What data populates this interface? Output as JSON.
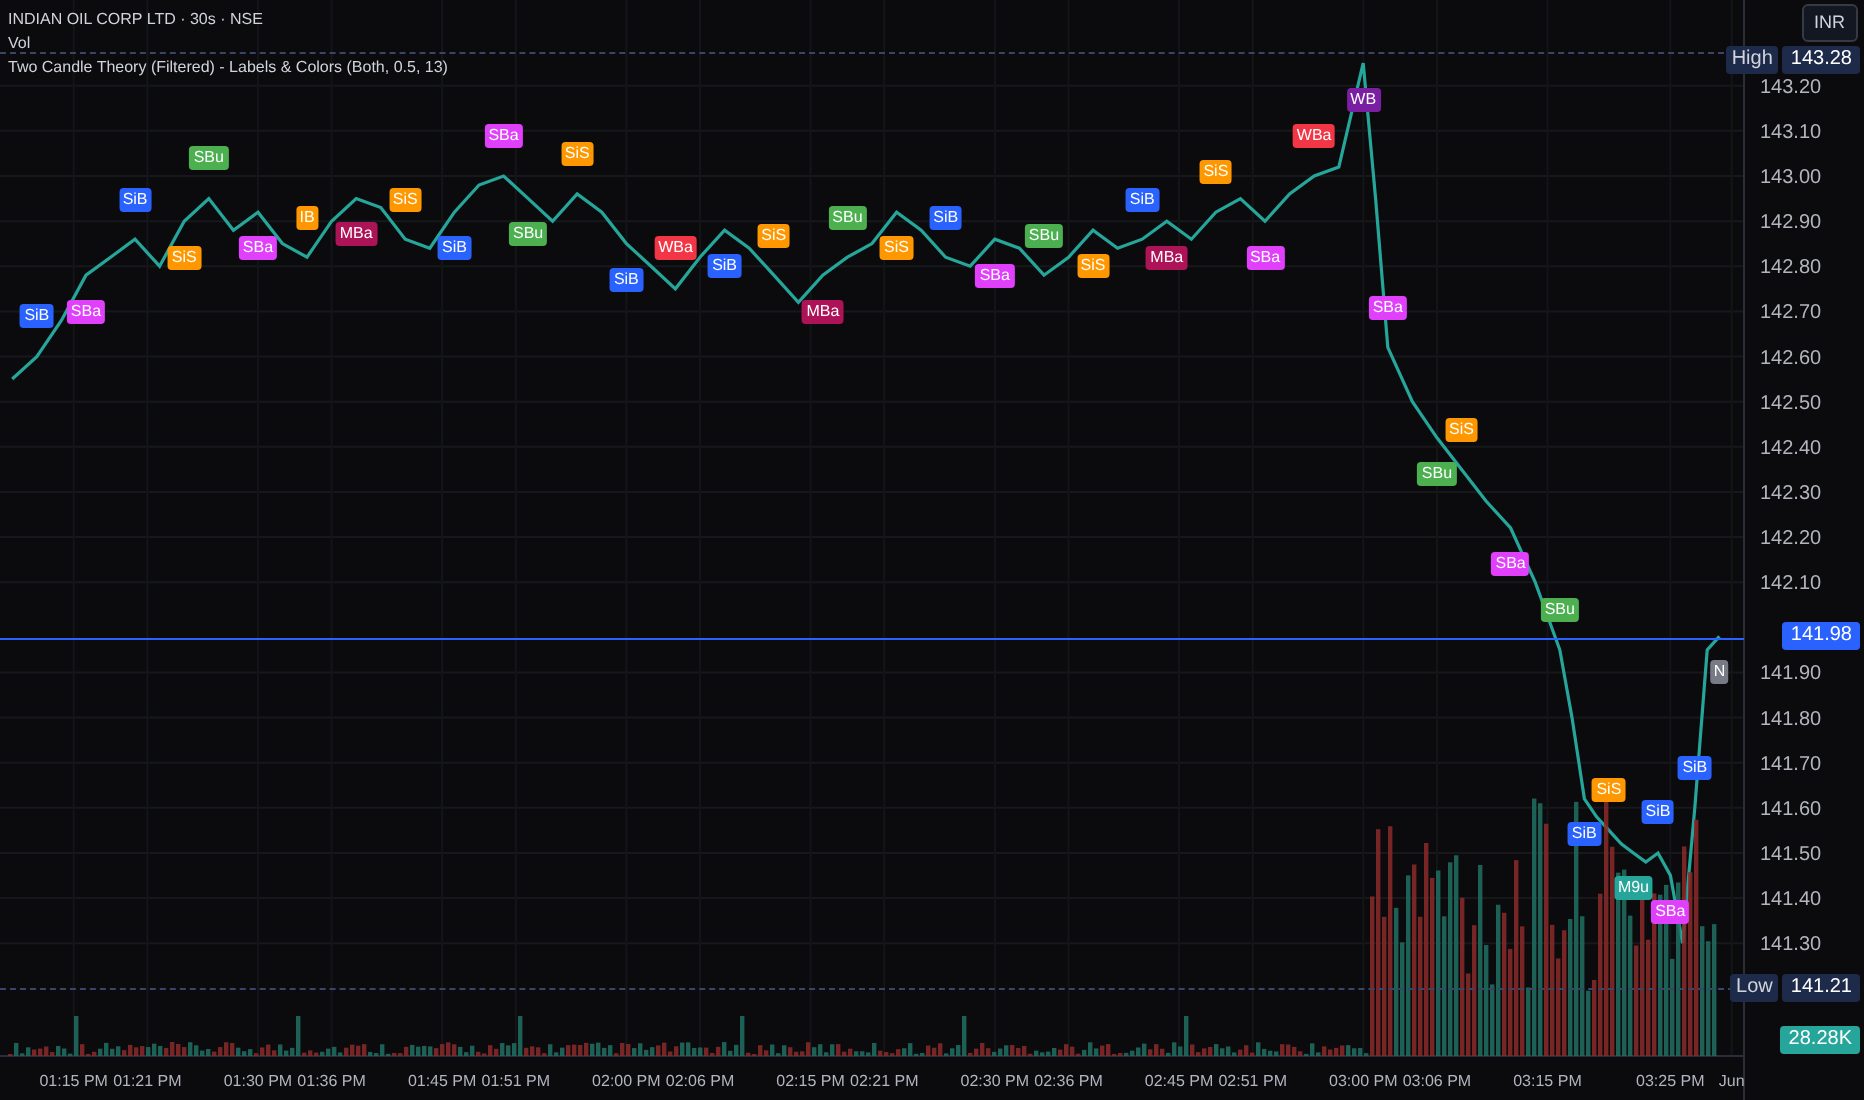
{
  "header": {
    "symbol": "INDIAN OIL CORP LTD · 30s · NSE",
    "volume_label": "Vol",
    "indicator": "Two Candle Theory (Filtered) - Labels & Colors (Both, 0.5, 13)"
  },
  "currency_button": "INR",
  "price_badges": [
    {
      "kind": "high",
      "label": "High",
      "value": "143.28"
    },
    {
      "kind": "last",
      "value": "141.98"
    },
    {
      "kind": "low",
      "label": "Low",
      "value": "141.21"
    },
    {
      "kind": "volume",
      "value": "28.28K"
    }
  ],
  "signals": [
    {
      "label": "SiB",
      "color": "#2962ff"
    },
    {
      "label": "SBa",
      "color": "#e040fb"
    },
    {
      "label": "SiB",
      "color": "#2962ff"
    },
    {
      "label": "SiS",
      "color": "#ff9800"
    },
    {
      "label": "SBu",
      "color": "#4caf50"
    },
    {
      "label": "SBa",
      "color": "#e040fb"
    },
    {
      "label": "IB",
      "color": "#ff9800"
    },
    {
      "label": "MBa",
      "color": "#ad1457"
    },
    {
      "label": "SiS",
      "color": "#ff9800"
    },
    {
      "label": "SiB",
      "color": "#2962ff"
    },
    {
      "label": "SBa",
      "color": "#e040fb"
    },
    {
      "label": "SBu",
      "color": "#4caf50"
    },
    {
      "label": "SiS",
      "color": "#ff9800"
    },
    {
      "label": "SiB",
      "color": "#2962ff"
    },
    {
      "label": "WBa",
      "color": "#f23645"
    },
    {
      "label": "SiB",
      "color": "#2962ff"
    },
    {
      "label": "SiS",
      "color": "#ff9800"
    },
    {
      "label": "MBa",
      "color": "#ad1457"
    },
    {
      "label": "SBu",
      "color": "#4caf50"
    },
    {
      "label": "SiS",
      "color": "#ff9800"
    },
    {
      "label": "SiB",
      "color": "#2962ff"
    },
    {
      "label": "SBa",
      "color": "#e040fb"
    },
    {
      "label": "SBu",
      "color": "#4caf50"
    },
    {
      "label": "SiS",
      "color": "#ff9800"
    },
    {
      "label": "SiB",
      "color": "#2962ff"
    },
    {
      "label": "MBa",
      "color": "#ad1457"
    },
    {
      "label": "SiS",
      "color": "#ff9800"
    },
    {
      "label": "SBa",
      "color": "#e040fb"
    },
    {
      "label": "WBa",
      "color": "#f23645"
    },
    {
      "label": "WB",
      "color": "#7b1fa2"
    },
    {
      "label": "SBa",
      "color": "#e040fb"
    },
    {
      "label": "SBu",
      "color": "#4caf50"
    },
    {
      "label": "SiS",
      "color": "#ff9800"
    },
    {
      "label": "SBa",
      "color": "#e040fb"
    },
    {
      "label": "SBu",
      "color": "#4caf50"
    },
    {
      "label": "SiB",
      "color": "#2962ff"
    },
    {
      "label": "SiS",
      "color": "#ff9800"
    },
    {
      "label": "M9u",
      "color": "#26a69a"
    },
    {
      "label": "SiB",
      "color": "#2962ff"
    },
    {
      "label": "SBa",
      "color": "#e040fb"
    },
    {
      "label": "SiB",
      "color": "#2962ff"
    },
    {
      "label": "N",
      "color": "#787b86"
    }
  ],
  "chart_data": {
    "type": "line",
    "grid": true,
    "x": [
      790,
      792,
      794,
      796,
      798,
      800,
      802,
      804,
      806,
      808,
      810,
      812,
      814,
      816,
      818,
      820,
      822,
      824,
      826,
      828,
      830,
      832,
      834,
      836,
      838,
      840,
      842,
      844,
      846,
      848,
      850,
      852,
      854,
      856,
      858,
      860,
      862,
      864,
      866,
      868,
      870,
      872,
      874,
      876,
      878,
      880,
      882,
      884,
      886,
      888,
      890,
      892,
      894,
      896,
      898,
      900,
      901,
      902,
      904,
      906,
      908,
      910,
      912,
      914,
      916,
      917,
      918,
      919,
      920,
      921,
      922,
      923,
      924,
      925,
      926,
      927,
      928,
      929
    ],
    "series": [
      {
        "color": "#26a69a",
        "values": [
          142.55,
          142.6,
          142.68,
          142.78,
          142.82,
          142.86,
          142.8,
          142.9,
          142.95,
          142.88,
          142.92,
          142.85,
          142.82,
          142.9,
          142.95,
          142.93,
          142.86,
          142.84,
          142.92,
          142.98,
          143.0,
          142.95,
          142.9,
          142.96,
          142.92,
          142.85,
          142.8,
          142.75,
          142.82,
          142.88,
          142.84,
          142.78,
          142.72,
          142.78,
          142.82,
          142.85,
          142.92,
          142.88,
          142.82,
          142.8,
          142.86,
          142.84,
          142.78,
          142.82,
          142.88,
          142.84,
          142.86,
          142.9,
          142.86,
          142.92,
          142.95,
          142.9,
          142.96,
          143.0,
          143.02,
          143.25,
          142.95,
          142.62,
          142.5,
          142.42,
          142.35,
          142.28,
          142.22,
          142.1,
          141.95,
          141.8,
          141.62,
          141.58,
          141.55,
          141.52,
          141.5,
          141.48,
          141.5,
          141.45,
          141.3,
          141.6,
          141.95,
          141.98
        ]
      }
    ],
    "xlim": [
      789,
      931
    ],
    "ylim": [
      141.05,
      143.39
    ],
    "yticks": [
      {
        "value": 141.3,
        "label": "141.30"
      },
      {
        "value": 141.4,
        "label": "141.40"
      },
      {
        "value": 141.5,
        "label": "141.50"
      },
      {
        "value": 141.6,
        "label": "141.60"
      },
      {
        "value": 141.7,
        "label": "141.70"
      },
      {
        "value": 141.8,
        "label": "141.80"
      },
      {
        "value": 141.9,
        "label": "141.90"
      },
      {
        "value": 142.1,
        "label": "142.10"
      },
      {
        "value": 142.2,
        "label": "142.20"
      },
      {
        "value": 142.3,
        "label": "142.30"
      },
      {
        "value": 142.4,
        "label": "142.40"
      },
      {
        "value": 142.5,
        "label": "142.50"
      },
      {
        "value": 142.6,
        "label": "142.60"
      },
      {
        "value": 142.7,
        "label": "142.70"
      },
      {
        "value": 142.8,
        "label": "142.80"
      },
      {
        "value": 142.9,
        "label": "142.90"
      },
      {
        "value": 143.0,
        "label": "143.00"
      },
      {
        "value": 143.1,
        "label": "143.10"
      },
      {
        "value": 143.2,
        "label": "143.20"
      }
    ],
    "xticks": [
      {
        "value": 795,
        "label": "01:15 PM"
      },
      {
        "value": 801,
        "label": "01:21 PM"
      },
      {
        "value": 810,
        "label": "01:30 PM"
      },
      {
        "value": 816,
        "label": "01:36 PM"
      },
      {
        "value": 825,
        "label": "01:45 PM"
      },
      {
        "value": 831,
        "label": "01:51 PM"
      },
      {
        "value": 840,
        "label": "02:00 PM"
      },
      {
        "value": 846,
        "label": "02:06 PM"
      },
      {
        "value": 855,
        "label": "02:15 PM"
      },
      {
        "value": 861,
        "label": "02:21 PM"
      },
      {
        "value": 870,
        "label": "02:30 PM"
      },
      {
        "value": 876,
        "label": "02:36 PM"
      },
      {
        "value": 885,
        "label": "02:45 PM"
      },
      {
        "value": 891,
        "label": "02:51 PM"
      },
      {
        "value": 900,
        "label": "03:00 PM"
      },
      {
        "value": 906,
        "label": "03:06 PM"
      },
      {
        "value": 915,
        "label": "03:15 PM"
      },
      {
        "value": 925,
        "label": "03:25 PM"
      },
      {
        "value": 930,
        "label": "Jun"
      }
    ]
  }
}
